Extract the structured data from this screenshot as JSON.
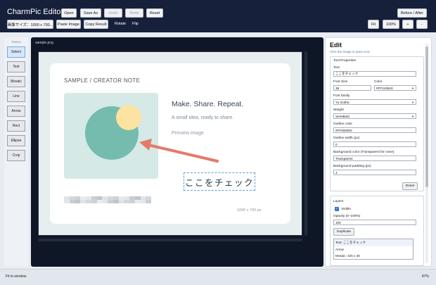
{
  "app": {
    "title": "CharmPic Editor"
  },
  "toolbar": {
    "open": "Open",
    "save_as": "Save As",
    "undo": "Undo",
    "redo": "Redo",
    "reset": "Reset",
    "before_after": "Before / After",
    "image_size": "画像サイズ：1000 x 700...",
    "paste_image": "Paste Image",
    "copy_result": "Copy Result",
    "rotate": "Rotate",
    "flip": "Flip",
    "fit": "Fit",
    "zoom": "100%",
    "zoom_in": "+",
    "zoom_out": "-"
  },
  "tools": {
    "title": "TOOLS",
    "items": [
      "Select",
      "Text",
      "Mosaic",
      "Line",
      "Arrow",
      "Rect",
      "Ellipse",
      "Crop"
    ],
    "active": "Select"
  },
  "canvas": {
    "filename": "sample.png",
    "card_heading": "SAMPLE / CREATOR NOTE",
    "headline": "Make. Share. Repeat.",
    "subline": "A small idea, ready to share.",
    "preview": "Preview image",
    "text_object": "ここをチェック",
    "dimensions": "1000 x 700 px",
    "colors": {
      "arrow": "#e47a6a",
      "big_circle": "#75bcae",
      "small_circle": "#fce3a1",
      "image_bg": "#d5e9e6"
    }
  },
  "edit": {
    "title": "Edit",
    "hint": "Click the image to place text.",
    "tool_properties": "Tool Properties",
    "text_label": "Text",
    "text_value": "ここをチェック",
    "font_size_label": "Font Size",
    "font_size_value": "38",
    "color_label": "Color",
    "color_value": "#FF243843",
    "font_family_label": "Font family",
    "font_family_value": "Yu Gothic",
    "weight_label": "Weight",
    "weight_value": "SemiBold",
    "outline_color_label": "Outline color",
    "outline_color_value": "#FF000000",
    "outline_width_label": "Outline width (px)",
    "outline_width_value": "0",
    "bg_color_label": "Background color (Transparent for none)",
    "bg_color_value": "Transparent",
    "bg_padding_label": "Background padding (px)",
    "bg_padding_value": "4",
    "reset": "Reset",
    "layers_label": "Layers",
    "visible_label": "Visible",
    "opacity_label": "Opacity (0–100%)",
    "opacity_value": "100",
    "duplicate": "Duplicate",
    "layers": [
      "Text: ここをチェック",
      "Arrow",
      "Mosaic: 425 x 48"
    ]
  },
  "status": {
    "left": "Fit to window.",
    "zoom": "87%"
  }
}
